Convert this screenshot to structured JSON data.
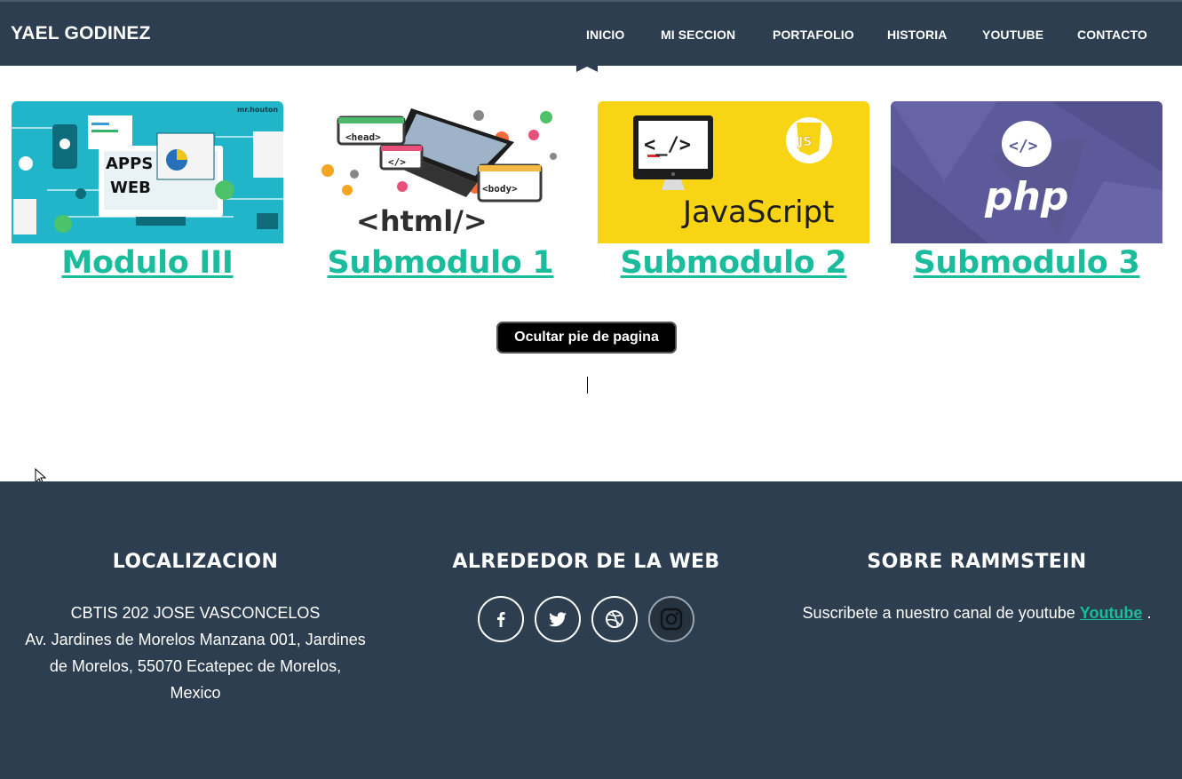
{
  "navbar": {
    "brand": "YAEL GODINEZ",
    "links": [
      "INICIO",
      "MI SECCION",
      "PORTAFOLIO",
      "HISTORIA",
      "YOUTUBE",
      "CONTACTO"
    ]
  },
  "cards": [
    {
      "label": "Modulo III",
      "image_text": [
        "APPS",
        "WEB"
      ],
      "watermark": "mr.houton"
    },
    {
      "label": "Submodulo 1",
      "image_text": [
        "<head>",
        "</>",
        "<body>",
        "<html/>"
      ]
    },
    {
      "label": "Submodulo 2",
      "image_text": [
        "<_/>",
        "JavaScript",
        "JS"
      ]
    },
    {
      "label": "Submodulo 3",
      "image_text": [
        "</>",
        "php"
      ]
    }
  ],
  "toggle_button": {
    "label": "Ocultar pie de pagina"
  },
  "footer": {
    "location": {
      "title": "LOCALIZACION",
      "lines": [
        "CBTIS 202 JOSE VASCONCELOS",
        "Av. Jardines de Morelos Manzana 001, Jardines",
        "de Morelos, 55070 Ecatepec de Morelos,",
        "Mexico"
      ]
    },
    "web": {
      "title": "ALREDEDOR DE LA WEB",
      "icons": [
        "facebook-icon",
        "twitter-icon",
        "dribbble-icon",
        "instagram-icon"
      ]
    },
    "about": {
      "title": "SOBRE RAMMSTEIN",
      "text": "Suscribete a nuestro canal de youtube",
      "link": "Youtube",
      "suffix": " ."
    }
  },
  "colors": {
    "navbar_bg": "#2c3e50",
    "footer_bg": "#2c3e50",
    "accent": "#1abc9c",
    "button_bg": "#000000"
  }
}
